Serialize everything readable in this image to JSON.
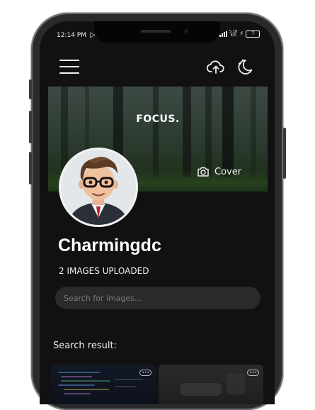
{
  "status_bar": {
    "time": "12:14 PM",
    "network_speed": "5.18",
    "network_unit": "K/S",
    "battery": "7"
  },
  "header": {
    "menu_icon": "hamburger-menu-icon",
    "upload_icon": "cloud-upload-icon",
    "theme_icon": "moon-stars-icon"
  },
  "cover": {
    "title": "FOCUS.",
    "button_label": "Cover"
  },
  "profile": {
    "name": "Charmingdc",
    "images_count_label": "2 IMAGES UPLOADED"
  },
  "search": {
    "placeholder": "Search for images...",
    "value": ""
  },
  "results": {
    "label": "Search result:",
    "items": [
      {
        "badge": "•••"
      },
      {
        "badge": "•••"
      }
    ]
  },
  "colors": {
    "background": "#111112",
    "search_field": "#2a2a2b",
    "text": "#ffffff"
  }
}
